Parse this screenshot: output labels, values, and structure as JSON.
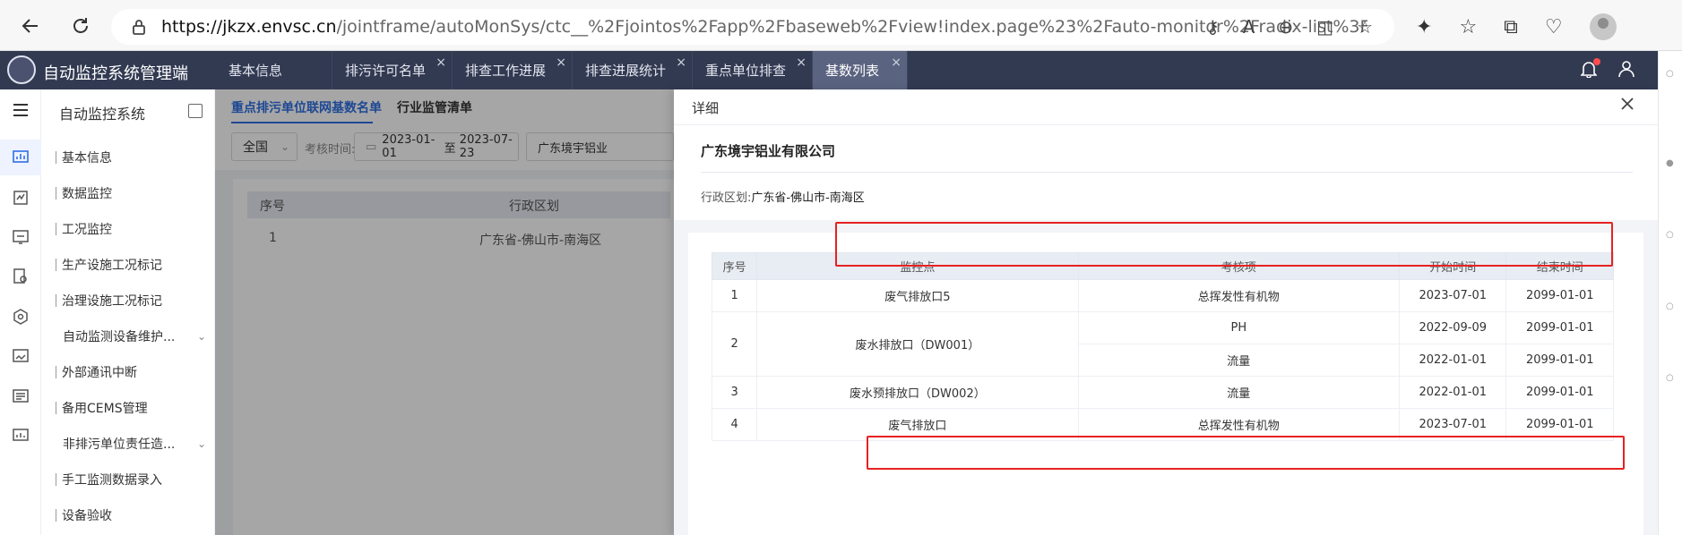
{
  "browser": {
    "url_host": "https://jkzx.envsc.cn",
    "url_path": "/jointframe/autoMonSys/ctc__%2Fjointos%2Fapp%2Fbaseweb%2Fview!index.page%23%2Fauto-monitor%2Fradix-list%3Fmenu..."
  },
  "app": {
    "title": "自动监控系统管理端",
    "tabs": [
      {
        "label": "基本信息",
        "closable": false
      },
      {
        "label": "排污许可名单",
        "closable": true
      },
      {
        "label": "排查工作进展",
        "closable": true
      },
      {
        "label": "排查进展统计",
        "closable": true
      },
      {
        "label": "重点单位排查",
        "closable": true
      },
      {
        "label": "基数列表",
        "closable": true,
        "active": true
      }
    ],
    "close_glyph": "×"
  },
  "sidebar": {
    "title": "自动监控系统",
    "items": [
      {
        "label": "基本信息"
      },
      {
        "label": "数据监控"
      },
      {
        "label": "工况监控"
      },
      {
        "label": "生产设施工况标记"
      },
      {
        "label": "治理设施工况标记"
      },
      {
        "label": "自动监测设备维护..."
      },
      {
        "label": "外部通讯中断"
      },
      {
        "label": "备用CEMS管理"
      },
      {
        "label": "非排污单位责任造..."
      },
      {
        "label": "手工监测数据录入"
      },
      {
        "label": "设备验收"
      }
    ]
  },
  "background_page": {
    "sub_tabs": [
      "重点排污单位联网基数名单",
      "行业监管清单"
    ],
    "filter_region": "全国",
    "filter_time_label": "考核时间:",
    "filter_date_start": "2023-01-01",
    "filter_date_sep": "至",
    "filter_date_end": "2023-07-23",
    "filter_company": "广东境宇铝业",
    "table_headers": [
      "序号",
      "行政区划"
    ],
    "table_rows": [
      {
        "index": "1",
        "region": "广东省-佛山市-南海区"
      }
    ]
  },
  "drawer": {
    "title": "详细",
    "company": "广东境宇铝业有限公司",
    "region_label": "行政区划:",
    "region_value": "广东省-佛山市-南海区",
    "headers": [
      "序号",
      "监控点",
      "考核项",
      "开始时间",
      "结束时间"
    ],
    "rows": [
      {
        "index": "1",
        "point": "废气排放口5",
        "item": "总挥发性有机物",
        "start": "2023-07-01",
        "end": "2099-01-01"
      },
      {
        "index": "2",
        "point": "废水排放口（DW001）",
        "item": "PH",
        "start": "2022-09-09",
        "end": "2099-01-01"
      },
      {
        "item": "流量",
        "start": "2022-01-01",
        "end": "2099-01-01"
      },
      {
        "index": "3",
        "point": "废水预排放口（DW002）",
        "item": "流量",
        "start": "2022-01-01",
        "end": "2099-01-01"
      },
      {
        "index": "4",
        "point": "废气排放口",
        "item": "总挥发性有机物",
        "start": "2023-07-01",
        "end": "2099-01-01"
      }
    ]
  },
  "colors": {
    "header_bg": "#323a52",
    "accent": "#2f6fe4",
    "annotation_red": "#e52222"
  }
}
